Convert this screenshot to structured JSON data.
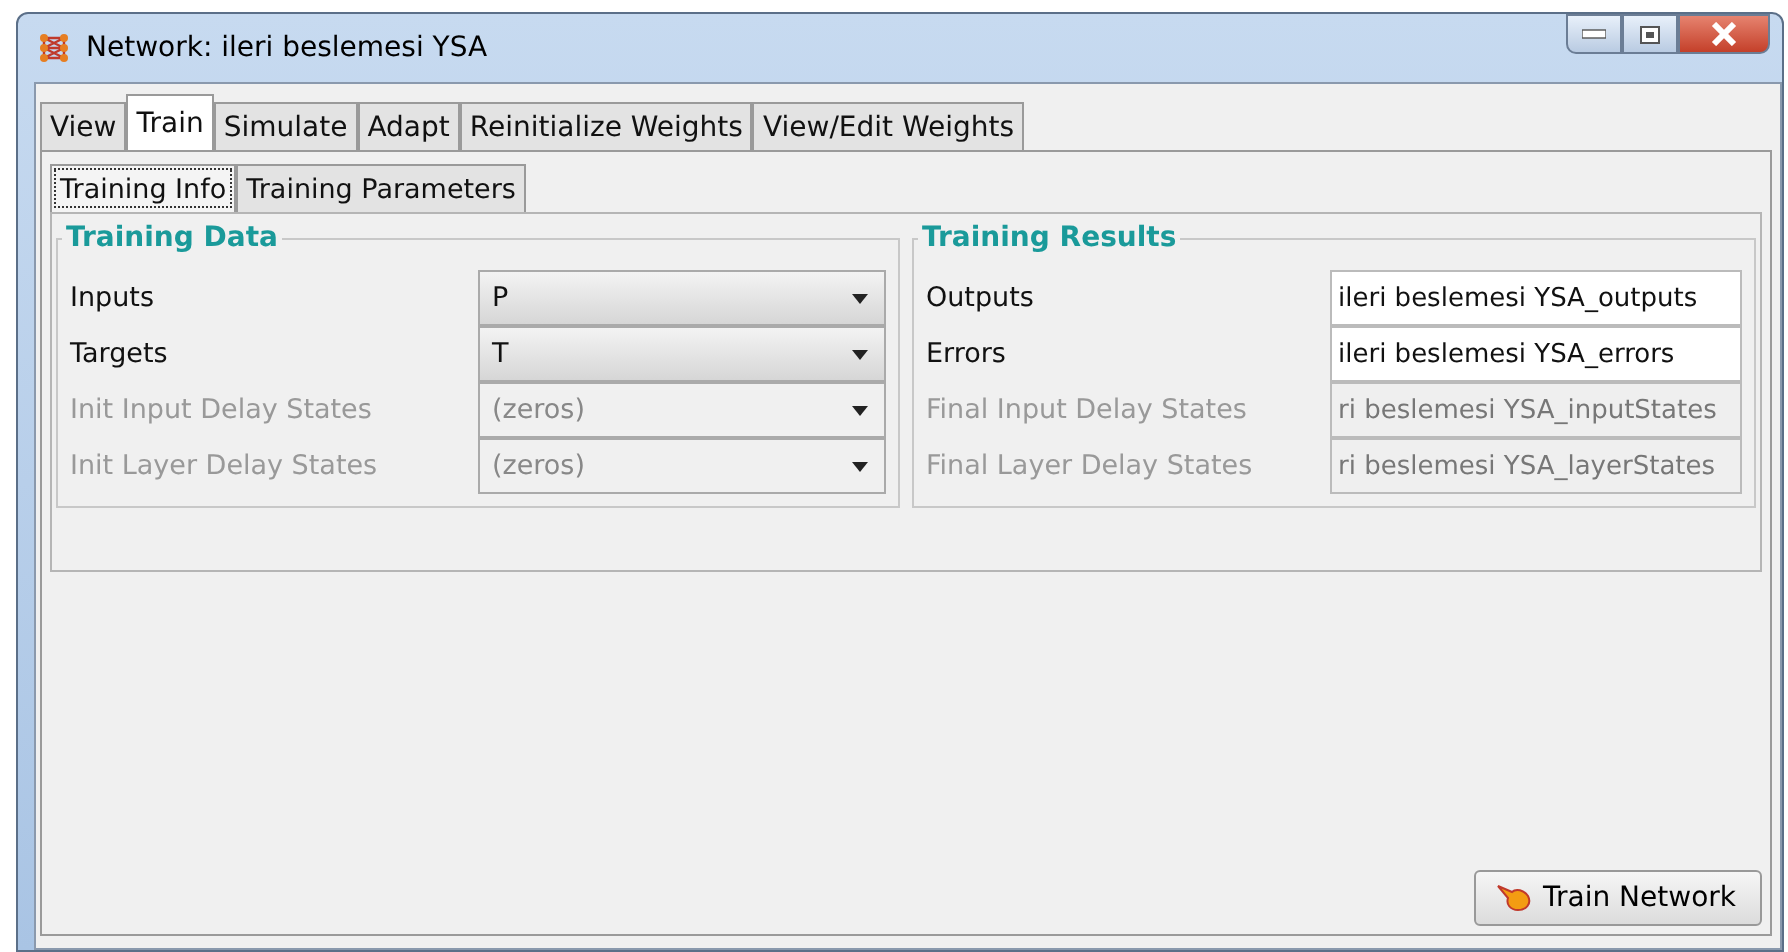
{
  "window": {
    "title": "Network: ileri beslemesi YSA"
  },
  "tabs": [
    {
      "label": "View",
      "selected": false
    },
    {
      "label": "Train",
      "selected": true
    },
    {
      "label": "Simulate",
      "selected": false
    },
    {
      "label": "Adapt",
      "selected": false
    },
    {
      "label": "Reinitialize Weights",
      "selected": false
    },
    {
      "label": "View/Edit Weights",
      "selected": false
    }
  ],
  "subtabs": [
    {
      "label": "Training Info",
      "selected": true
    },
    {
      "label": "Training Parameters",
      "selected": false
    }
  ],
  "groups": [
    {
      "title": "Training Data",
      "rows": [
        {
          "kind": "dropdown",
          "label": "Inputs",
          "value": "P",
          "disabled": false
        },
        {
          "kind": "dropdown",
          "label": "Targets",
          "value": "T",
          "disabled": false
        },
        {
          "kind": "dropdown",
          "label": "Init Input Delay States",
          "value": "(zeros)",
          "disabled": true
        },
        {
          "kind": "dropdown",
          "label": "Init Layer Delay States",
          "value": "(zeros)",
          "disabled": true
        }
      ]
    },
    {
      "title": "Training Results",
      "rows": [
        {
          "kind": "text",
          "label": "Outputs",
          "value": "ileri beslemesi YSA_outputs",
          "disabled": false
        },
        {
          "kind": "text",
          "label": "Errors",
          "value": "ileri beslemesi YSA_errors",
          "disabled": false
        },
        {
          "kind": "text",
          "label": "Final Input Delay States",
          "value": "ri beslemesi YSA_inputStates",
          "disabled": true
        },
        {
          "kind": "text",
          "label": "Final Layer Delay States",
          "value": "ri beslemesi YSA_layerStates",
          "disabled": true
        }
      ]
    }
  ],
  "train_button": {
    "label": "Train Network"
  }
}
